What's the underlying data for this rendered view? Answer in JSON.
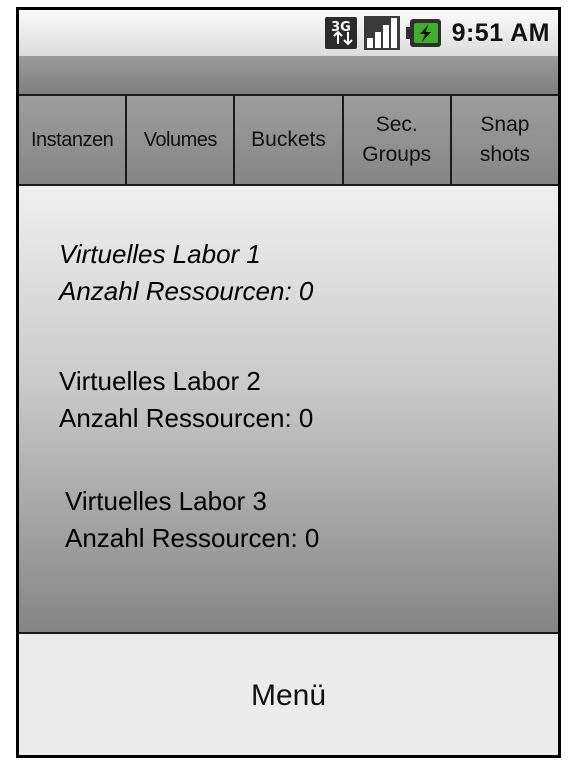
{
  "status_bar": {
    "network_type": "3G",
    "time": "9:51 AM",
    "icons": [
      "3g-data-icon",
      "signal-strength-icon",
      "battery-charging-icon"
    ]
  },
  "tabs": [
    {
      "label": "Instanzen"
    },
    {
      "label": "Volumes"
    },
    {
      "label": "Buckets"
    },
    {
      "label": "Sec.\nGroups"
    },
    {
      "label": "Snap\nshots"
    }
  ],
  "labs": [
    {
      "name": "Virtuelles Labor 1",
      "resources": "Anzahl Ressourcen: 0",
      "italic": true
    },
    {
      "name": "Virtuelles Labor 2",
      "resources": "Anzahl Ressourcen: 0",
      "italic": false
    },
    {
      "name": "Virtuelles Labor 3",
      "resources": "Anzahl Ressourcen: 0",
      "italic": false
    }
  ],
  "menu": {
    "label": "Menü"
  },
  "colors": {
    "battery_green": "#3fae2a",
    "frame": "#000000"
  }
}
